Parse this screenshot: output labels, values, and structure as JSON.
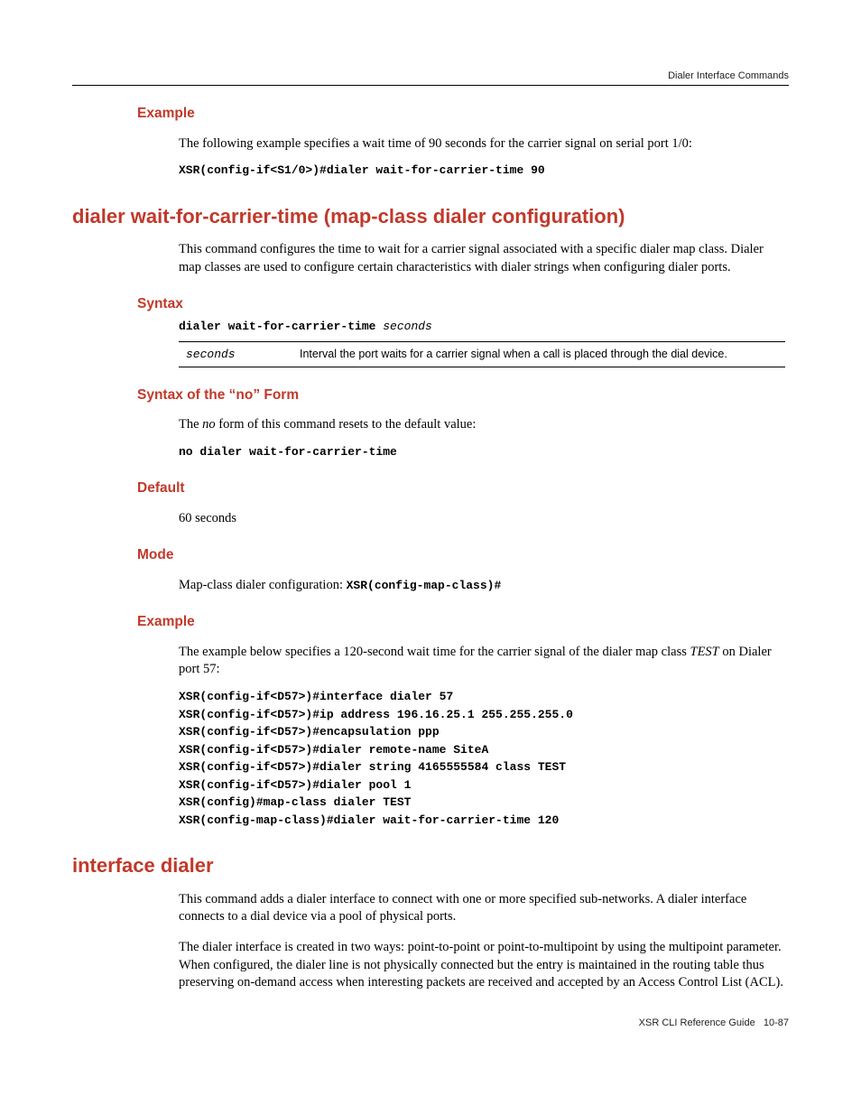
{
  "running_head": "Dialer Interface Commands",
  "sec1": {
    "example_h": "Example",
    "example_p": "The following example specifies a wait time of 90 seconds for the carrier signal on serial port 1/0:",
    "example_code": "XSR(config-if<S1/0>)#dialer wait-for-carrier-time 90"
  },
  "sec2": {
    "title": "dialer wait-for-carrier-time (map-class dialer configuration)",
    "intro": "This command configures the time to wait for a carrier signal associated with a specific dialer map class. Dialer map classes are used to configure certain characteristics with dialer strings when configuring dialer ports.",
    "syntax_h": "Syntax",
    "syntax_cmd": "dialer wait-for-carrier-time ",
    "syntax_arg": "seconds",
    "param_name": "seconds",
    "param_desc": "Interval the port waits for a carrier signal when a call is placed through the dial device.",
    "no_h": "Syntax of the “no” Form",
    "no_p_pre": "The ",
    "no_p_em": "no",
    "no_p_post": " form of this command resets to the default value:",
    "no_code": "no dialer wait-for-carrier-time",
    "default_h": "Default",
    "default_p": "60 seconds",
    "mode_h": "Mode",
    "mode_p_text": "Map-class dialer configuration: ",
    "mode_p_code": "XSR(config-map-class)#",
    "example_h": "Example",
    "example_p_pre": "The example below specifies a 120-second wait time for the carrier signal of the dialer map class ",
    "example_p_em": "TEST",
    "example_p_post": " on Dialer port 57:",
    "example_code": "XSR(config-if<D57>)#interface dialer 57\nXSR(config-if<D57>)#ip address 196.16.25.1 255.255.255.0\nXSR(config-if<D57>)#encapsulation ppp\nXSR(config-if<D57>)#dialer remote-name SiteA\nXSR(config-if<D57>)#dialer string 4165555584 class TEST\nXSR(config-if<D57>)#dialer pool 1\nXSR(config)#map-class dialer TEST\nXSR(config-map-class)#dialer wait-for-carrier-time 120"
  },
  "sec3": {
    "title": "interface dialer",
    "p1": "This command adds a dialer interface to connect with one or more specified sub-networks. A dialer interface connects to a dial device via a pool of physical ports.",
    "p2": "The dialer interface is created in two ways: point-to-point or point-to-multipoint by using the multipoint parameter. When configured, the dialer line is not physically connected but the entry is maintained in the routing table thus preserving on-demand access when interesting packets are received and accepted by an Access Control List (ACL)."
  },
  "footer_doc": "XSR CLI Reference Guide",
  "footer_page": "10-87"
}
